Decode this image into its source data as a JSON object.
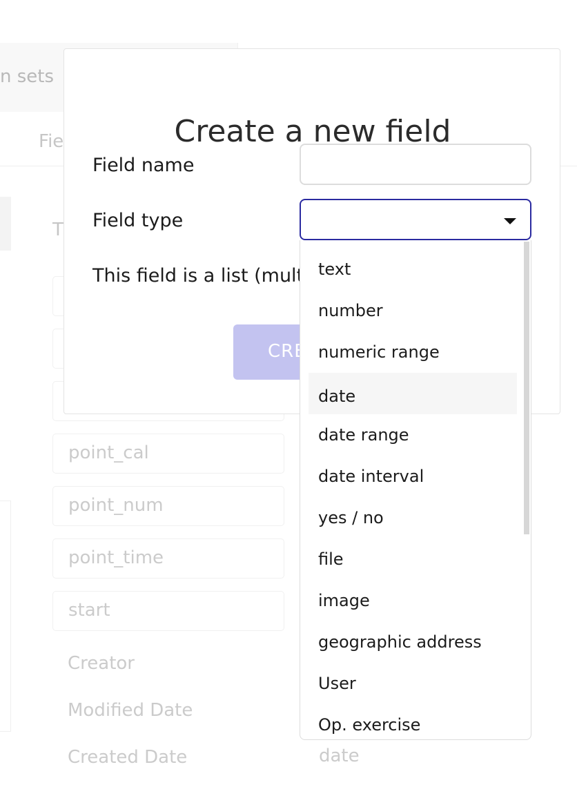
{
  "background": {
    "topbar_label": "n sets",
    "tab_label": "Fie",
    "letter": "T",
    "boxed_fields": [
      "",
      "",
      "",
      "point_cal",
      "point_num",
      "point_time",
      "start"
    ],
    "plain_fields": [
      "Creator",
      "Modified Date",
      "Created Date"
    ],
    "created_date_type": "date"
  },
  "modal": {
    "title": "Create a new field",
    "field_name_label": "Field name",
    "field_name_value": "",
    "field_type_label": "Field type",
    "field_type_value": "",
    "list_label": "This field is a list (multip",
    "create_button": "CRE"
  },
  "dropdown": {
    "hover_index": 3,
    "options": [
      "text",
      "number",
      "numeric range",
      "date",
      "date range",
      "date interval",
      "yes / no",
      "file",
      "image",
      "geographic address",
      "User",
      "Op. exercise"
    ]
  },
  "colors": {
    "focus_border": "#2a2aa0",
    "button_disabled": "#c3c3f0",
    "hover_bg": "#f6f6f6"
  }
}
